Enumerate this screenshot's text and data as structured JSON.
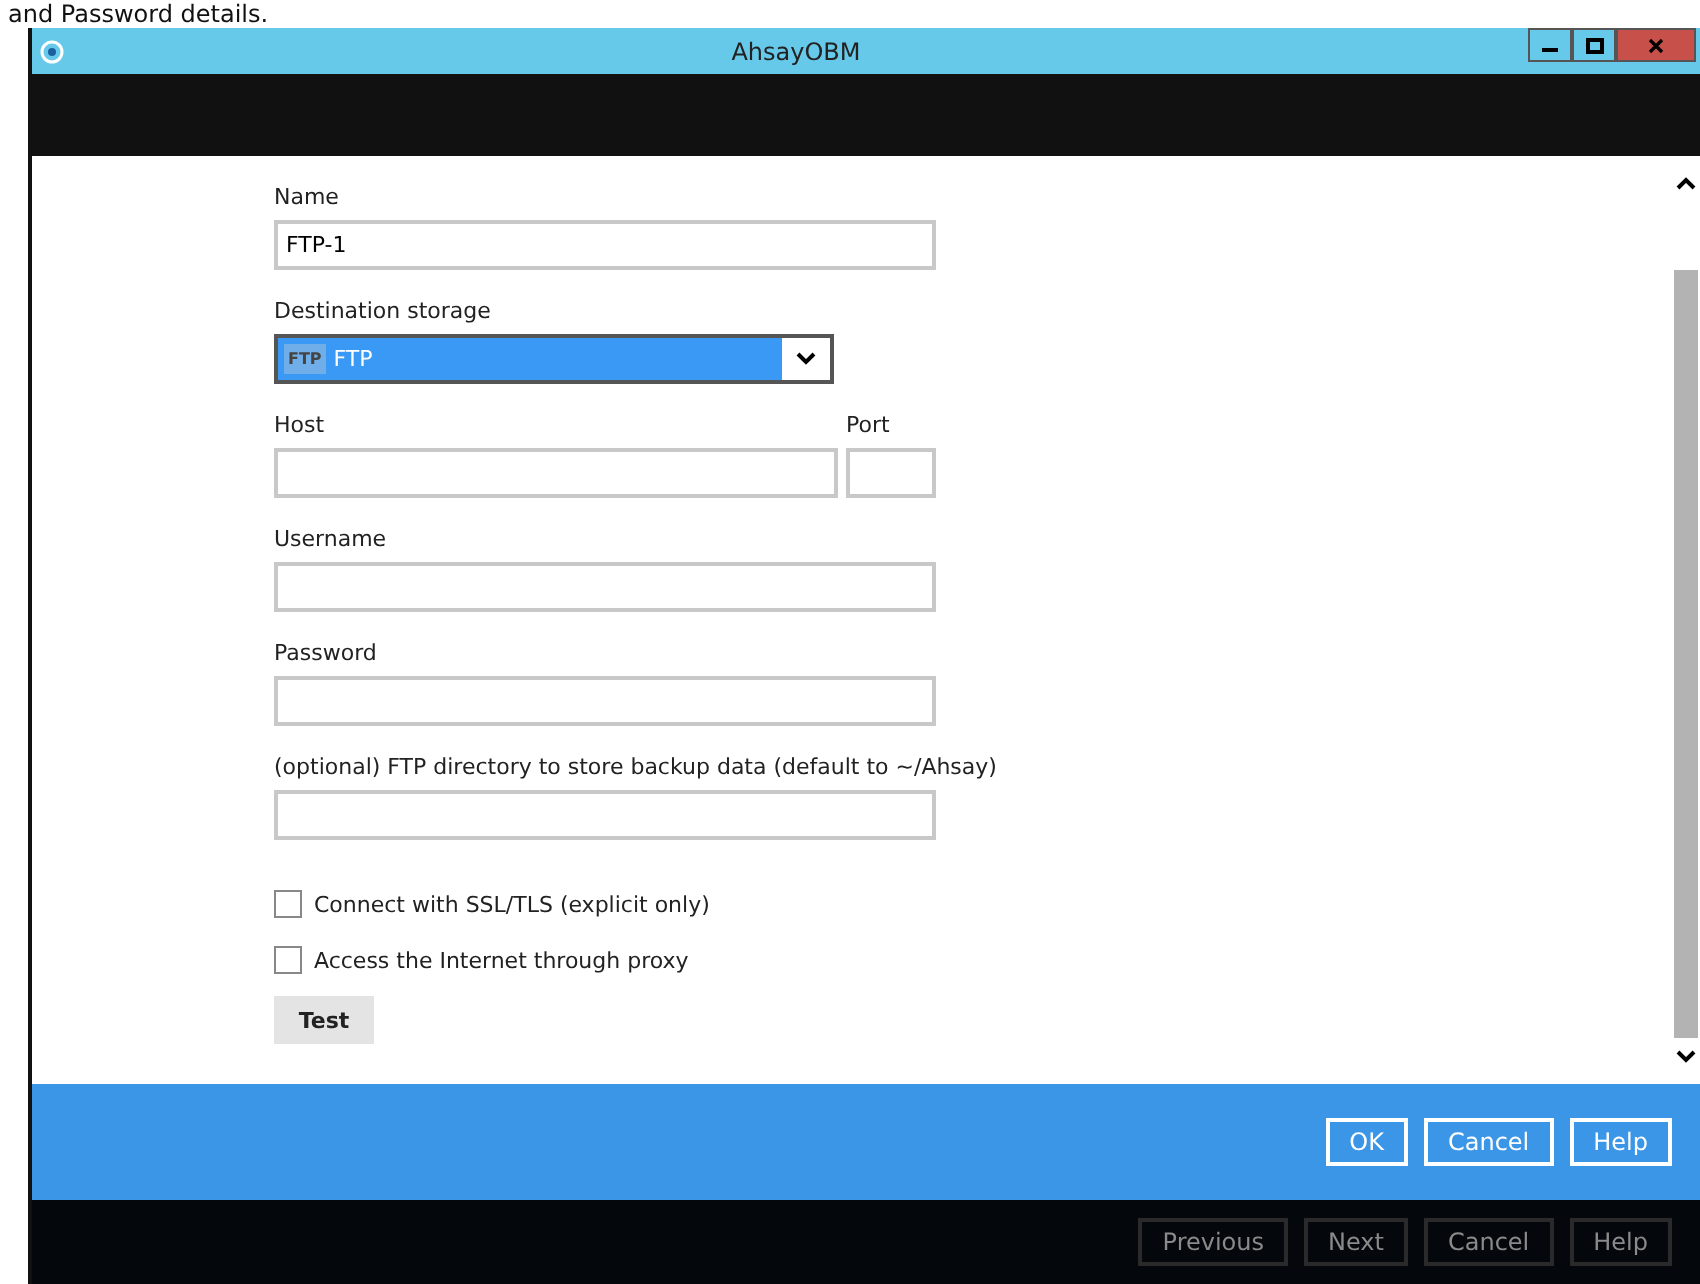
{
  "caption": "and Password details.",
  "window": {
    "title": "AhsayOBM"
  },
  "form": {
    "name": {
      "label": "Name",
      "value": "FTP-1"
    },
    "destination": {
      "label": "Destination storage",
      "badge": "FTP",
      "value": "FTP"
    },
    "host": {
      "label": "Host"
    },
    "port": {
      "label": "Port"
    },
    "fields": [
      {
        "label": "Username"
      },
      {
        "label": "Password"
      },
      {
        "label": "(optional) FTP directory to store backup data (default to ~/Ahsay)"
      }
    ],
    "options": [
      {
        "label": "Connect with SSL/TLS (explicit only)",
        "checked": false
      },
      {
        "label": "Access the Internet through proxy",
        "checked": false
      }
    ],
    "test_button": "Test"
  },
  "dialog_buttons": [
    "OK",
    "Cancel",
    "Help"
  ],
  "background_buttons": [
    "Previous",
    "Next",
    "Cancel",
    "Help"
  ]
}
